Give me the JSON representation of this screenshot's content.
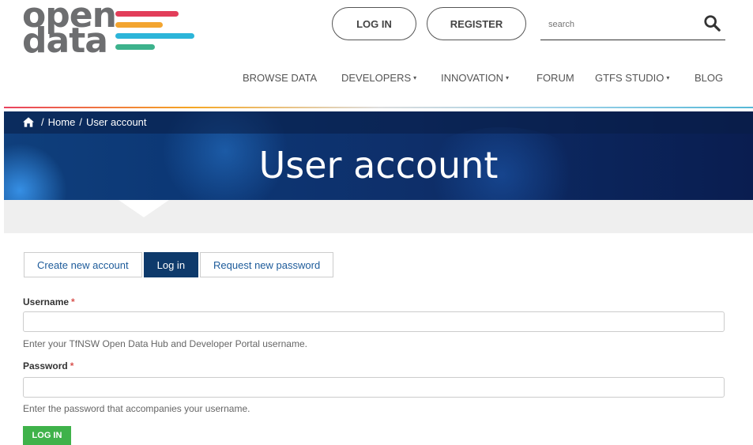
{
  "logo": {
    "line1": "open",
    "line2": "data",
    "stripe_colors": [
      "#e23e5a",
      "#f3a530",
      "#2cb5d9",
      "#3db28c"
    ]
  },
  "header": {
    "login_label": "LOG IN",
    "register_label": "REGISTER",
    "search_placeholder": "search"
  },
  "nav": {
    "items": [
      {
        "label": "BROWSE DATA"
      },
      {
        "label": "DEVELOPERS",
        "caret": "▾"
      },
      {
        "label": "INNOVATION",
        "caret": "▾"
      },
      {
        "label": "FORUM"
      },
      {
        "label": "GTFS STUDIO",
        "caret": "▾"
      },
      {
        "label": "BLOG"
      }
    ]
  },
  "breadcrumb": {
    "home": "Home",
    "current": "User account",
    "separator": "/"
  },
  "page": {
    "title": "User account"
  },
  "tabs": [
    {
      "label": "Create new account"
    },
    {
      "label": "Log in",
      "active": true
    },
    {
      "label": "Request new password"
    }
  ],
  "form": {
    "username_label": "Username",
    "required_mark": "*",
    "username_value": "",
    "username_help": "Enter your TfNSW Open Data Hub and Developer Portal username.",
    "password_label": "Password",
    "password_value": "",
    "password_help": "Enter the password that accompanies your username.",
    "submit_label": "LOG IN"
  },
  "colors": {
    "accent_navy": "#0e3a6b",
    "submit_green": "#3fb24a",
    "required_red": "#d9534f"
  }
}
